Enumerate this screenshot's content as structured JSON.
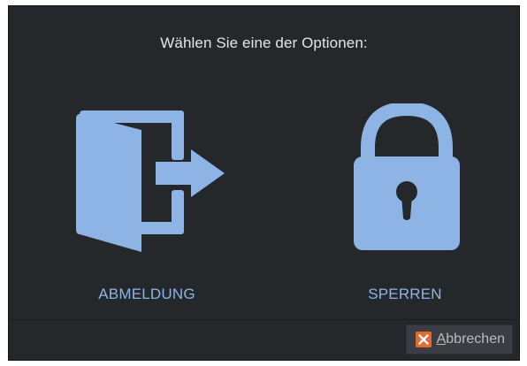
{
  "dialog": {
    "prompt": "Wählen Sie eine der Optionen:",
    "options": [
      {
        "label": "ABMELDUNG",
        "icon": "logout-door-icon"
      },
      {
        "label": "SPERREN",
        "icon": "padlock-icon"
      }
    ],
    "cancel": {
      "mnemonic": "A",
      "label_rest": "bbrechen",
      "icon": "close-icon"
    }
  },
  "colors": {
    "background": "#25282b",
    "accent": "#8eb4e6",
    "text": "#e3e5e7",
    "cancel_icon": "#e26a2c"
  }
}
